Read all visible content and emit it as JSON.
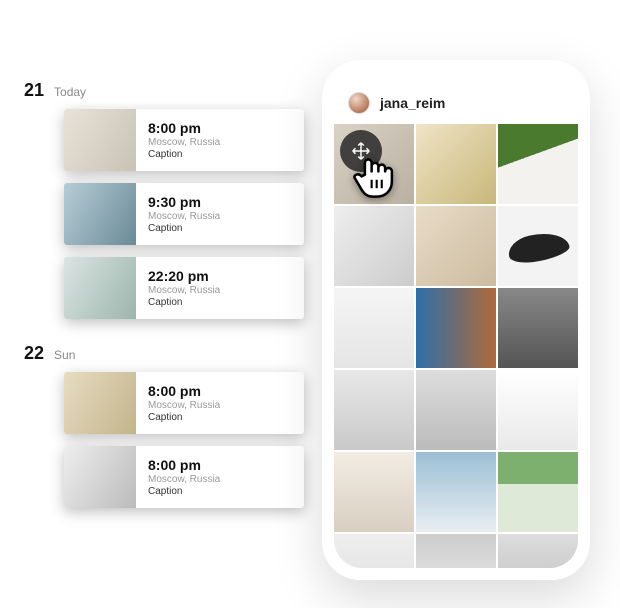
{
  "schedule": {
    "days": [
      {
        "number": "21",
        "label": "Today",
        "posts": [
          {
            "time": "8:00 pm",
            "location": "Moscow, Russia",
            "caption": "Caption"
          },
          {
            "time": "9:30 pm",
            "location": "Moscow, Russia",
            "caption": "Caption"
          },
          {
            "time": "22:20 pm",
            "location": "Moscow, Russia",
            "caption": "Caption"
          }
        ]
      },
      {
        "number": "22",
        "label": "Sun",
        "posts": [
          {
            "time": "8:00 pm",
            "location": "Moscow, Russia",
            "caption": "Caption"
          },
          {
            "time": "8:00 pm",
            "location": "Moscow, Russia",
            "caption": "Caption"
          }
        ]
      }
    ]
  },
  "phone": {
    "username": "jana_reim",
    "drag_icon": "move-arrows-icon",
    "cursor_icon": "drag-hand-cursor",
    "grid_tiles": [
      "photo",
      "photo",
      "photo",
      "photo",
      "photo",
      "sneaker",
      "photo",
      "photo",
      "photo",
      "photo",
      "photo",
      "photo",
      "photo",
      "photo",
      "photo",
      "photo",
      "photo",
      "photo"
    ]
  }
}
